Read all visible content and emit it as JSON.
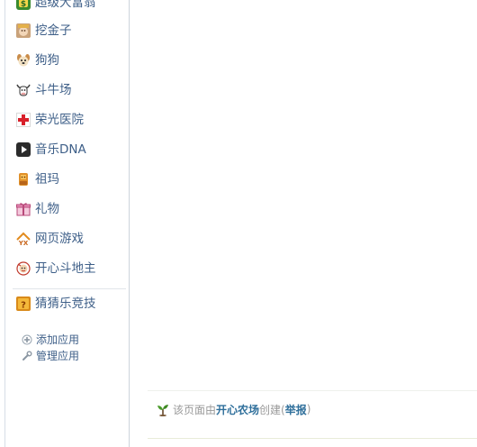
{
  "sidebar": {
    "apps": [
      {
        "label": "超级大富翁",
        "icon": "rich-man-icon"
      },
      {
        "label": "挖金子",
        "icon": "gold-miner-icon"
      },
      {
        "label": "狗狗",
        "icon": "dog-icon"
      },
      {
        "label": "斗牛场",
        "icon": "bull-icon"
      },
      {
        "label": "荣光医院",
        "icon": "hospital-cross-icon"
      },
      {
        "label": "音乐DNA",
        "icon": "music-play-icon"
      },
      {
        "label": "祖玛",
        "icon": "zuma-icon"
      },
      {
        "label": "礼物",
        "icon": "gift-icon"
      },
      {
        "label": "网页游戏",
        "icon": "web-game-icon"
      },
      {
        "label": "开心斗地主",
        "icon": "landlord-card-icon"
      },
      {
        "label": "猜猜乐竞技",
        "icon": "guess-icon"
      }
    ],
    "manage": [
      {
        "label": "添加应用",
        "icon": "plus-icon"
      },
      {
        "label": "管理应用",
        "icon": "wrench-icon"
      }
    ]
  },
  "footer": {
    "prefix": "该页面由",
    "creator": "开心农场",
    "middle": "创建(",
    "report": "举报",
    "suffix": ")"
  },
  "colors": {
    "link": "#3e5f88",
    "footer_text": "#999999",
    "footer_link": "#2f6f9b"
  }
}
